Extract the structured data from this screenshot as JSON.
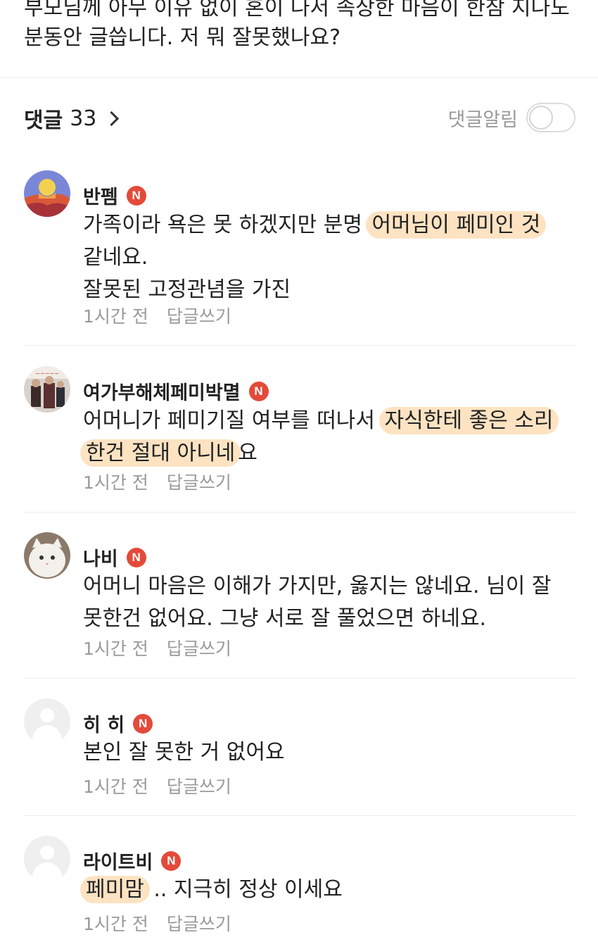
{
  "post": {
    "cut_line": "부모님께 아무 이유 없이 혼이 나서 속상한 마음이 한참 지나도",
    "last_line": "분동안 글씁니다. 저 뭐 잘못했나요?"
  },
  "comments_header": {
    "label": "댓글",
    "count": "33",
    "alarm_label": "댓글알림",
    "alarm_on": false
  },
  "comments": [
    {
      "nick": "반펨",
      "badge": "N",
      "lines": [
        {
          "pre": "가족이라 욕은 못 하겠지만 분명 ",
          "hl": "어머님이 페미인 것",
          "post": ""
        },
        {
          "pre": "같네요.",
          "hl": "",
          "post": ""
        },
        {
          "pre": "잘못된 고정관념을 가진",
          "hl": "",
          "post": ""
        }
      ],
      "time": "1시간 전",
      "reply": "답글쓰기"
    },
    {
      "nick": "여가부해체페미박멸",
      "badge": "N",
      "lines": [
        {
          "pre": "어머니가 페미기질 여부를 떠나서 ",
          "hl": "자식한테 좋은 소리",
          "post": ""
        },
        {
          "pre": "",
          "hl": "한건 절대 아니네",
          "post": "요"
        }
      ],
      "time": "1시간 전",
      "reply": "답글쓰기"
    },
    {
      "nick": "나비",
      "badge": "N",
      "lines": [
        {
          "pre": "어머니 마음은 이해가 가지만, 옳지는 않네요. 님이 잘",
          "hl": "",
          "post": ""
        },
        {
          "pre": "못한건 없어요. 그냥 서로 잘 풀었으면 하네요.",
          "hl": "",
          "post": ""
        }
      ],
      "time": "1시간 전",
      "reply": "답글쓰기"
    },
    {
      "nick": "히 히",
      "badge": "N",
      "lines": [
        {
          "pre": "본인 잘 못한 거 없어요",
          "hl": "",
          "post": ""
        }
      ],
      "time": "1시간 전",
      "reply": "답글쓰기"
    },
    {
      "nick": "라이트비",
      "badge": "N",
      "lines": [
        {
          "pre": "",
          "hl": "페미맘",
          "post": " .. 지극히 정상 이세요"
        }
      ],
      "time": "1시간 전",
      "reply": "답글쓰기"
    }
  ],
  "colors": {
    "highlight": "#fde3c2",
    "badge": "#e34a3a",
    "meta": "#9a9a9a",
    "divider": "#ececec"
  }
}
